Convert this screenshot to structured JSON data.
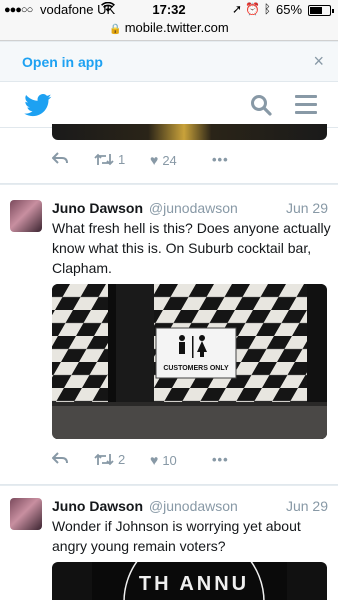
{
  "status_bar": {
    "signal": "●●●○○",
    "carrier": "vodafone UK",
    "time": "17:32",
    "battery_percent": "65%",
    "battery_level": 0.65
  },
  "url_bar": {
    "domain": "mobile.twitter.com"
  },
  "banner": {
    "open_in_app": "Open in app",
    "close_symbol": "×"
  },
  "tweets": [
    {
      "replies": "",
      "retweets": "1",
      "likes": "24"
    },
    {
      "name": "Juno Dawson",
      "handle": "@junodawson",
      "date": "Jun 29",
      "text": "What fresh hell is this? Does anyone actually know what this is. On Suburb cocktail bar, Clapham.",
      "sign_text": "CUSTOMERS ONLY",
      "retweets": "2",
      "likes": "10"
    },
    {
      "name": "Juno Dawson",
      "handle": "@junodawson",
      "date": "Jun 29",
      "text": "Wonder if Johnson is worrying yet about angry young remain voters?",
      "image_text": "TH ANNU"
    }
  ],
  "colors": {
    "twitter_blue": "#1da1f2",
    "icon_grey": "#8899a6",
    "text_dark": "#14171a",
    "divider": "#e1e8ed"
  }
}
